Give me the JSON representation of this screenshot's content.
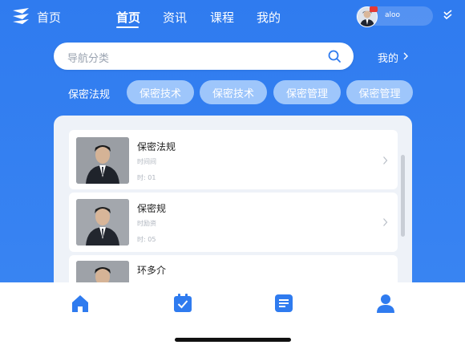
{
  "header": {
    "home_label": "首页",
    "nav": [
      "首页",
      "资讯",
      "课程",
      "我的"
    ],
    "username": "aloo"
  },
  "search": {
    "placeholder": "导航分类"
  },
  "mine_link": "我的",
  "chips": {
    "plain": "保密法规",
    "items": [
      "保密技术",
      "保密技术",
      "保密管理",
      "保密管理"
    ]
  },
  "list": [
    {
      "title": "保密法规",
      "line1": "时间间",
      "line2": "时: 01"
    },
    {
      "title": "保密规",
      "line1": "时励资",
      "line2": "时: 05"
    },
    {
      "title": "环多介",
      "line1": "",
      "line2": ""
    }
  ],
  "colors": {
    "primary": "#2f7bef",
    "chip": "#9ec6fb",
    "tab_icon": "#2f7bef"
  },
  "bottom_nav": [
    "home-icon",
    "calendar-check-icon",
    "list-icon",
    "user-icon"
  ]
}
